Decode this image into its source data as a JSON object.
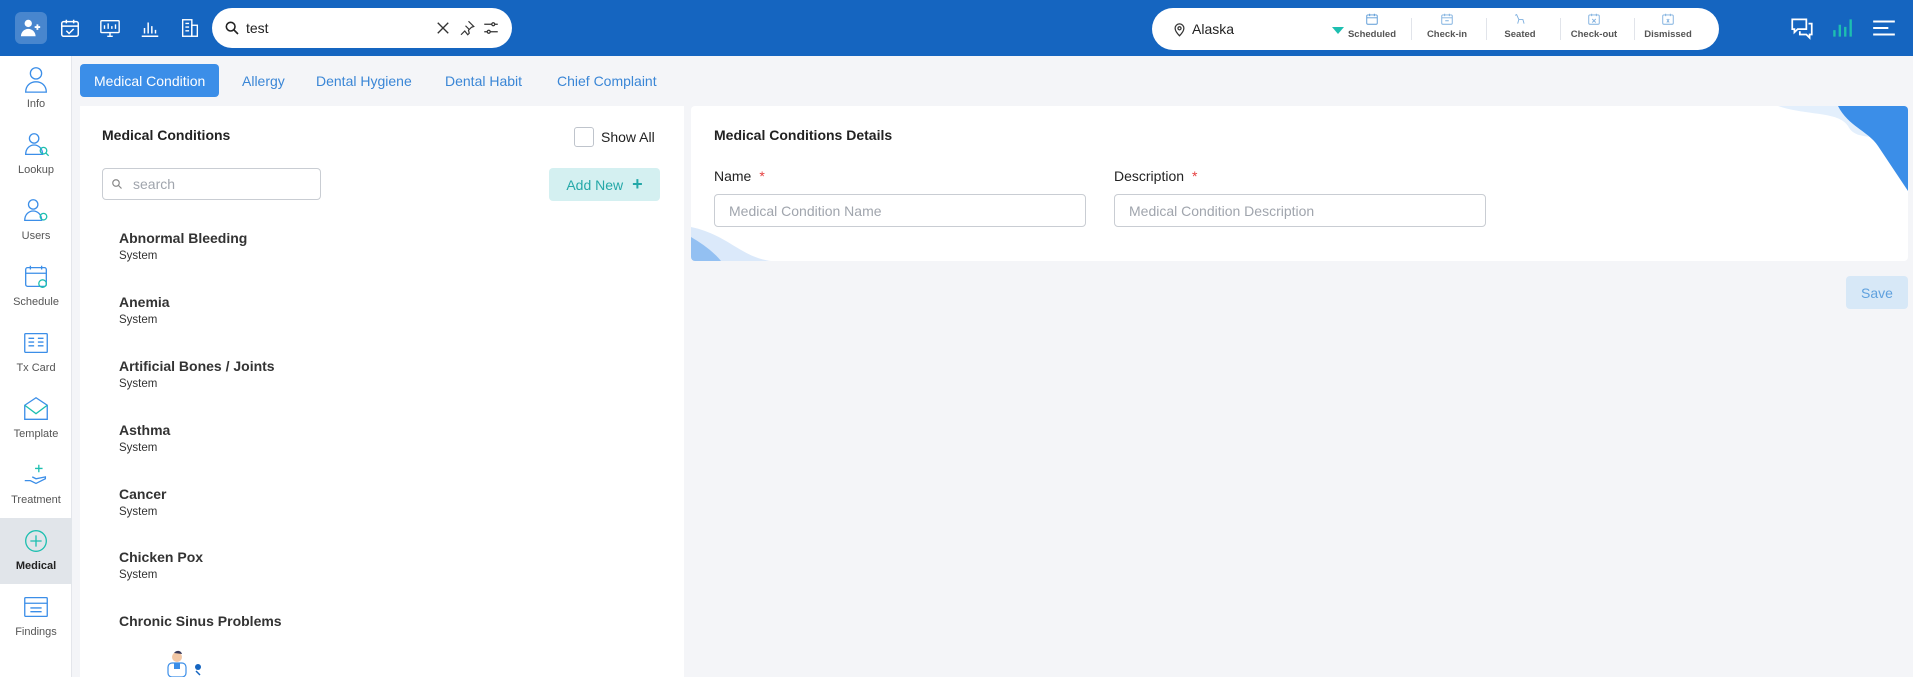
{
  "topbar": {
    "search": {
      "value": "test"
    },
    "location": {
      "name": "Alaska"
    },
    "status_tabs": [
      {
        "label": "Scheduled",
        "icon": "calendar-icon"
      },
      {
        "label": "Check-in",
        "icon": "checkin-icon"
      },
      {
        "label": "Seated",
        "icon": "chair-icon"
      },
      {
        "label": "Check-out",
        "icon": "checkout-icon"
      },
      {
        "label": "Dismissed",
        "icon": "dismissed-icon"
      }
    ]
  },
  "sidebar": {
    "items": [
      {
        "label": "Info",
        "icon": "person-icon"
      },
      {
        "label": "Lookup",
        "icon": "lookup-icon"
      },
      {
        "label": "Users",
        "icon": "users-icon"
      },
      {
        "label": "Schedule",
        "icon": "schedule-icon"
      },
      {
        "label": "Tx Card",
        "icon": "txcard-icon"
      },
      {
        "label": "Template",
        "icon": "template-icon"
      },
      {
        "label": "Treatment",
        "icon": "treatment-icon"
      },
      {
        "label": "Medical",
        "icon": "medical-icon",
        "active": true
      },
      {
        "label": "Findings",
        "icon": "findings-icon"
      }
    ]
  },
  "tabs": [
    {
      "label": "Medical Condition",
      "active": true
    },
    {
      "label": "Allergy"
    },
    {
      "label": "Dental Hygiene"
    },
    {
      "label": "Dental Habit"
    },
    {
      "label": "Chief Complaint"
    }
  ],
  "left_panel": {
    "title": "Medical Conditions",
    "show_all_label": "Show All",
    "search_placeholder": "search",
    "add_new_label": "Add New",
    "items": [
      {
        "name": "Abnormal Bleeding",
        "source": "System"
      },
      {
        "name": "Anemia",
        "source": "System"
      },
      {
        "name": "Artificial Bones / Joints",
        "source": "System"
      },
      {
        "name": "Asthma",
        "source": "System"
      },
      {
        "name": "Cancer",
        "source": "System"
      },
      {
        "name": "Chicken Pox",
        "source": "System"
      },
      {
        "name": "Chronic Sinus Problems"
      }
    ]
  },
  "right_panel": {
    "title": "Medical Conditions Details",
    "name_label": "Name",
    "name_placeholder": "Medical Condition Name",
    "description_label": "Description",
    "description_placeholder": "Medical Condition Description",
    "required_mark": "*"
  },
  "save_label": "Save",
  "colors": {
    "topbar": "#1565c0",
    "accent": "#3b8ee8",
    "teal": "#1dbfb0"
  }
}
